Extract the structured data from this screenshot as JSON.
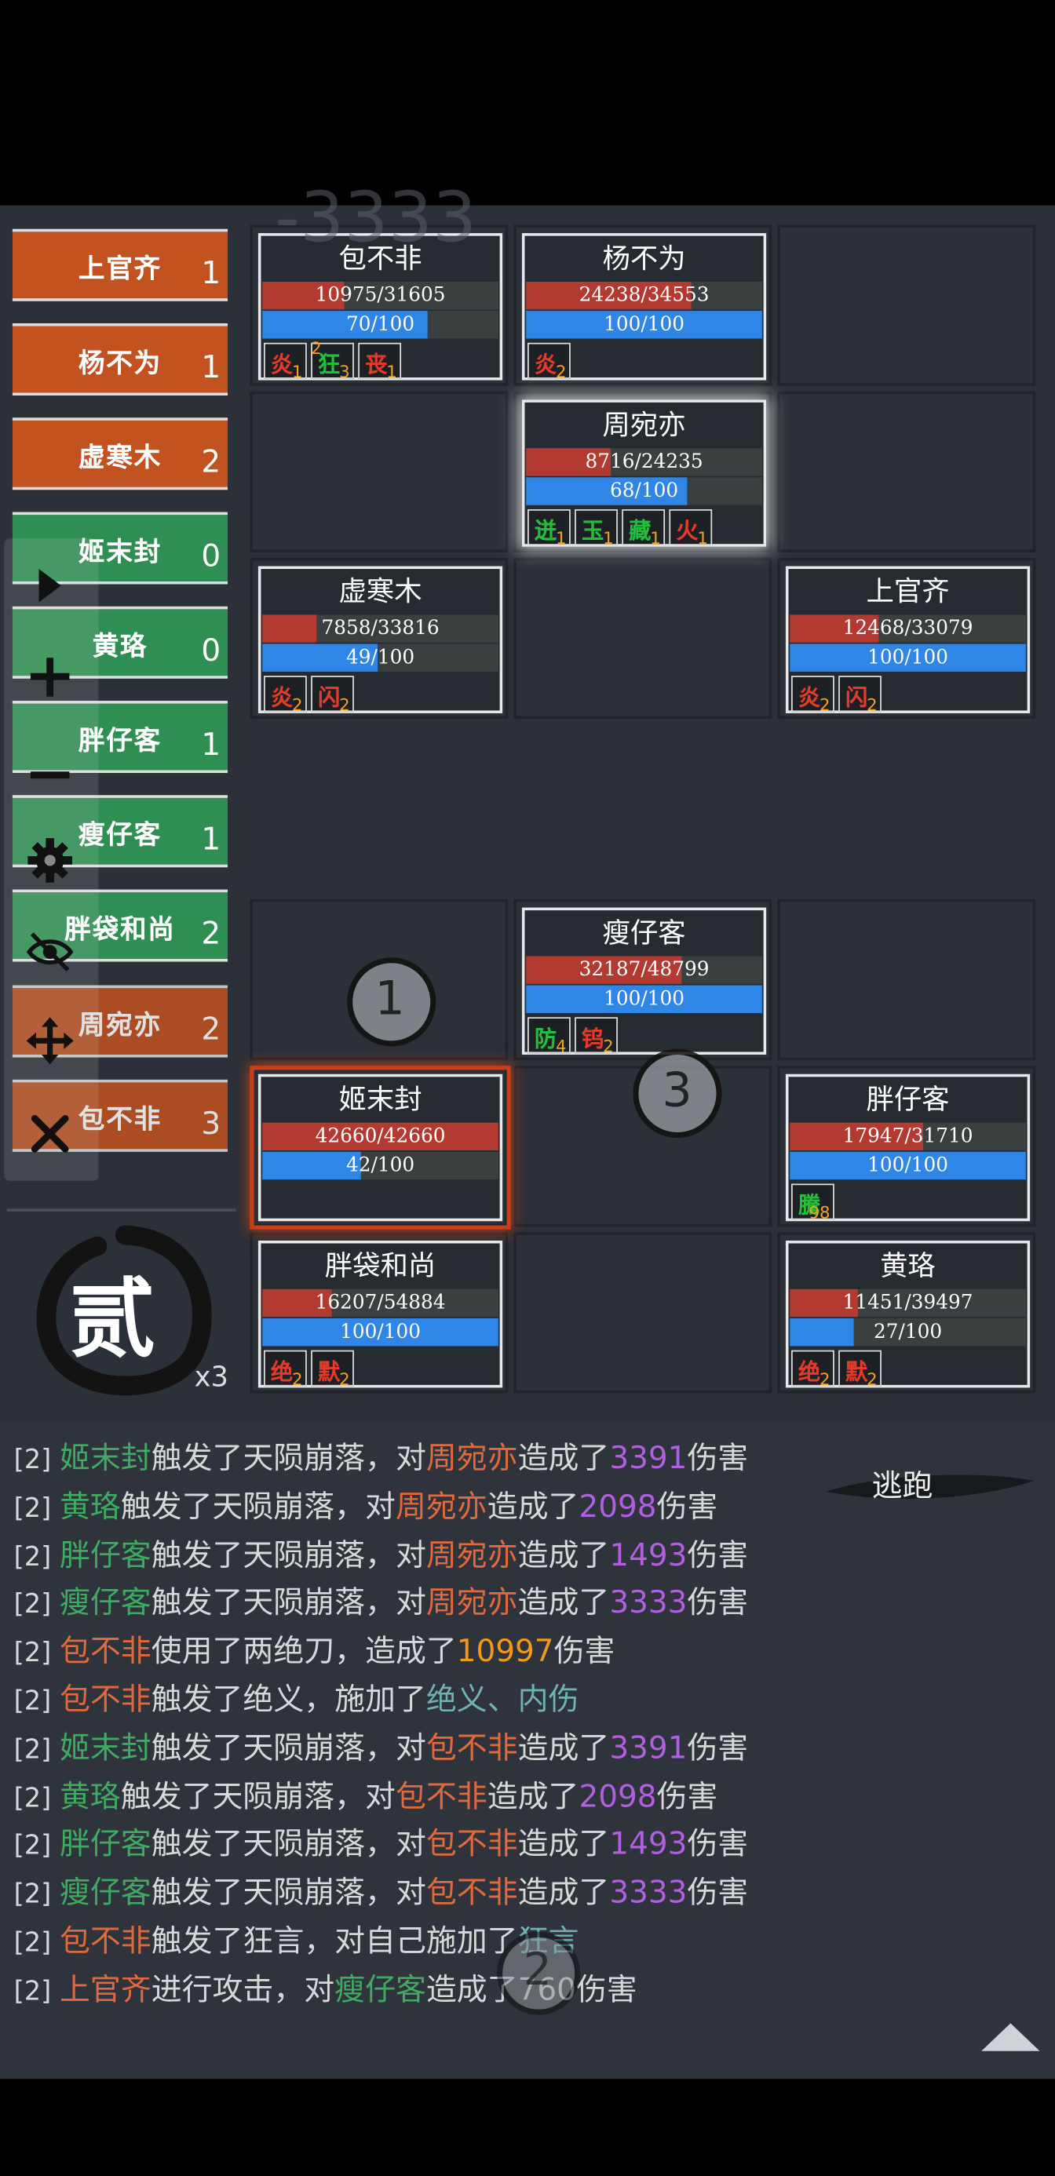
{
  "damage_popup": "-3333",
  "turn_order": [
    {
      "name": "上官齐",
      "count": "1",
      "team": "enemy"
    },
    {
      "name": "杨不为",
      "count": "1",
      "team": "enemy"
    },
    {
      "name": "虚寒木",
      "count": "2",
      "team": "enemy"
    },
    {
      "name": "姬末封",
      "count": "0",
      "team": "ally"
    },
    {
      "name": "黄珞",
      "count": "0",
      "team": "ally"
    },
    {
      "name": "胖仔客",
      "count": "1",
      "team": "ally"
    },
    {
      "name": "瘦仔客",
      "count": "1",
      "team": "ally"
    },
    {
      "name": "胖袋和尚",
      "count": "2",
      "team": "ally"
    },
    {
      "name": "周宛亦",
      "count": "2",
      "team": "enemy"
    },
    {
      "name": "包不非",
      "count": "3",
      "team": "enemy"
    }
  ],
  "units": [
    {
      "name": "包不非",
      "hp": "10975/31605",
      "hp_frac": 0.347,
      "mp": "70/100",
      "mp_frac": 0.7,
      "buffs": [
        {
          "ch": "炎",
          "n": "1",
          "color": "#e23b2a"
        },
        {
          "ch": "狂",
          "n": "3",
          "color": "#22c03a",
          "pre": "2"
        },
        {
          "ch": "丧",
          "n": "1",
          "color": "#e23b2a"
        }
      ]
    },
    {
      "name": "杨不为",
      "hp": "24238/34553",
      "hp_frac": 0.701,
      "mp": "100/100",
      "mp_frac": 1.0,
      "buffs": [
        {
          "ch": "炎",
          "n": "2",
          "color": "#e23b2a"
        }
      ]
    },
    {
      "name": "周宛亦",
      "hp": "8716/24235",
      "hp_frac": 0.36,
      "mp": "68/100",
      "mp_frac": 0.68,
      "buffs": [
        {
          "ch": "迸",
          "n": "1",
          "color": "#22c03a"
        },
        {
          "ch": "玉",
          "n": "1",
          "color": "#22c03a"
        },
        {
          "ch": "藏",
          "n": "1",
          "color": "#22c03a"
        },
        {
          "ch": "火",
          "n": "1",
          "color": "#e23b2a"
        }
      ]
    },
    {
      "name": "虚寒木",
      "hp": "7858/33816",
      "hp_frac": 0.232,
      "mp": "49/100",
      "mp_frac": 0.49,
      "buffs": [
        {
          "ch": "炎",
          "n": "2",
          "color": "#e23b2a"
        },
        {
          "ch": "闪",
          "n": "2",
          "color": "#e23b2a"
        }
      ]
    },
    {
      "name": "上官齐",
      "hp": "12468/33079",
      "hp_frac": 0.377,
      "mp": "100/100",
      "mp_frac": 1.0,
      "buffs": [
        {
          "ch": "炎",
          "n": "2",
          "color": "#e23b2a"
        },
        {
          "ch": "闪",
          "n": "2",
          "color": "#e23b2a"
        }
      ]
    },
    {
      "name": "瘦仔客",
      "hp": "32187/48799",
      "hp_frac": 0.66,
      "mp": "100/100",
      "mp_frac": 1.0,
      "buffs": [
        {
          "ch": "防",
          "n": "4",
          "color": "#22c03a"
        },
        {
          "ch": "钨",
          "n": "2",
          "color": "#e23b2a"
        }
      ]
    },
    {
      "name": "姬末封",
      "hp": "42660/42660",
      "hp_frac": 1.0,
      "mp": "42/100",
      "mp_frac": 0.42,
      "buffs": []
    },
    {
      "name": "胖仔客",
      "hp": "17947/31710",
      "hp_frac": 0.566,
      "mp": "100/100",
      "mp_frac": 1.0,
      "buffs": [
        {
          "ch": "騰",
          "n": "98",
          "color": "#22c03a"
        }
      ]
    },
    {
      "name": "胖袋和尚",
      "hp": "16207/54884",
      "hp_frac": 0.295,
      "mp": "100/100",
      "mp_frac": 1.0,
      "buffs": [
        {
          "ch": "绝",
          "n": "2",
          "color": "#e23b2a"
        },
        {
          "ch": "默",
          "n": "2",
          "color": "#e23b2a"
        }
      ]
    },
    {
      "name": "黄珞",
      "hp": "11451/39497",
      "hp_frac": 0.29,
      "mp": "27/100",
      "mp_frac": 0.27,
      "buffs": [
        {
          "ch": "绝",
          "n": "2",
          "color": "#e23b2a"
        },
        {
          "ch": "默",
          "n": "2",
          "color": "#e23b2a"
        }
      ]
    }
  ],
  "turn": {
    "label": "贰",
    "speed": "x3"
  },
  "escape_label": "逃跑",
  "markers": [
    "1",
    "3",
    "2"
  ],
  "toolbar": [
    "play-icon",
    "plus-icon",
    "minus-icon",
    "gear-icon",
    "eye-off-icon",
    "move-icon",
    "close-icon"
  ],
  "log": [
    [
      {
        "t": "[2] ",
        "c": "idx"
      },
      {
        "t": "姬末封",
        "c": "cg"
      },
      {
        "t": "触发了天陨崩落，对"
      },
      {
        "t": "周宛亦",
        "c": "cr"
      },
      {
        "t": "造成了"
      },
      {
        "t": "3391",
        "c": "cp"
      },
      {
        "t": "伤害"
      }
    ],
    [
      {
        "t": "[2] ",
        "c": "idx"
      },
      {
        "t": "黄珞",
        "c": "cg"
      },
      {
        "t": "触发了天陨崩落，对"
      },
      {
        "t": "周宛亦",
        "c": "cr"
      },
      {
        "t": "造成了"
      },
      {
        "t": "2098",
        "c": "cp"
      },
      {
        "t": "伤害"
      }
    ],
    [
      {
        "t": "[2] ",
        "c": "idx"
      },
      {
        "t": "胖仔客",
        "c": "cg"
      },
      {
        "t": "触发了天陨崩落，对"
      },
      {
        "t": "周宛亦",
        "c": "cr"
      },
      {
        "t": "造成了"
      },
      {
        "t": "1493",
        "c": "cp"
      },
      {
        "t": "伤害"
      }
    ],
    [
      {
        "t": "[2] ",
        "c": "idx"
      },
      {
        "t": "瘦仔客",
        "c": "cg"
      },
      {
        "t": "触发了天陨崩落，对"
      },
      {
        "t": "周宛亦",
        "c": "cr"
      },
      {
        "t": "造成了"
      },
      {
        "t": "3333",
        "c": "cp"
      },
      {
        "t": "伤害"
      }
    ],
    [
      {
        "t": "[2] ",
        "c": "idx"
      },
      {
        "t": "包不非",
        "c": "cr"
      },
      {
        "t": "使用了两绝刀，造成了"
      },
      {
        "t": "10997",
        "c": "co"
      },
      {
        "t": "伤害"
      }
    ],
    [
      {
        "t": "[2] ",
        "c": "idx"
      },
      {
        "t": "包不非",
        "c": "cr"
      },
      {
        "t": "触发了绝义，施加了"
      },
      {
        "t": "绝义、内伤",
        "c": "ct"
      }
    ],
    [
      {
        "t": "[2] ",
        "c": "idx"
      },
      {
        "t": "姬末封",
        "c": "cg"
      },
      {
        "t": "触发了天陨崩落，对"
      },
      {
        "t": "包不非",
        "c": "cr"
      },
      {
        "t": "造成了"
      },
      {
        "t": "3391",
        "c": "cp"
      },
      {
        "t": "伤害"
      }
    ],
    [
      {
        "t": "[2] ",
        "c": "idx"
      },
      {
        "t": "黄珞",
        "c": "cg"
      },
      {
        "t": "触发了天陨崩落，对"
      },
      {
        "t": "包不非",
        "c": "cr"
      },
      {
        "t": "造成了"
      },
      {
        "t": "2098",
        "c": "cp"
      },
      {
        "t": "伤害"
      }
    ],
    [
      {
        "t": "[2] ",
        "c": "idx"
      },
      {
        "t": "胖仔客",
        "c": "cg"
      },
      {
        "t": "触发了天陨崩落，对"
      },
      {
        "t": "包不非",
        "c": "cr"
      },
      {
        "t": "造成了"
      },
      {
        "t": "1493",
        "c": "cp"
      },
      {
        "t": "伤害"
      }
    ],
    [
      {
        "t": "[2] ",
        "c": "idx"
      },
      {
        "t": "瘦仔客",
        "c": "cg"
      },
      {
        "t": "触发了天陨崩落，对"
      },
      {
        "t": "包不非",
        "c": "cr"
      },
      {
        "t": "造成了"
      },
      {
        "t": "3333",
        "c": "cp"
      },
      {
        "t": "伤害"
      }
    ],
    [
      {
        "t": "[2] ",
        "c": "idx"
      },
      {
        "t": "包不非",
        "c": "cr"
      },
      {
        "t": "触发了狂言，对自己施加了"
      },
      {
        "t": "狂言",
        "c": "ct"
      }
    ],
    [
      {
        "t": "[2] ",
        "c": "idx"
      },
      {
        "t": "上官齐",
        "c": "cr"
      },
      {
        "t": "进行攻击，对"
      },
      {
        "t": "瘦仔客",
        "c": "cg"
      },
      {
        "t": "造成了760伤害"
      }
    ]
  ],
  "colors": {
    "enemy": "#c2521f",
    "ally": "#2f8e52",
    "board": "#2c3038",
    "hp": "#b23a30",
    "mp": "#2f86e6"
  }
}
